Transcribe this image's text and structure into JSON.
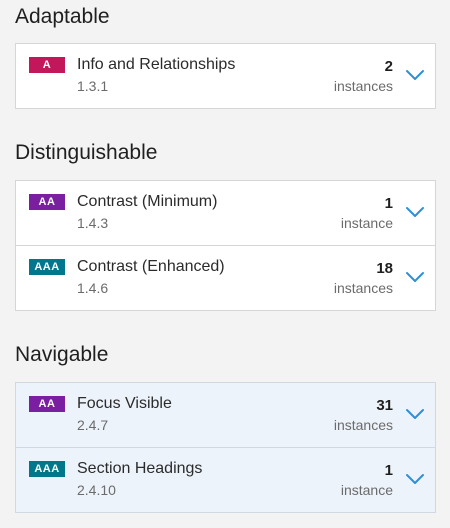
{
  "sections": [
    {
      "title": "Adaptable",
      "rows": [
        {
          "level": "A",
          "name": "Info and Relationships",
          "code": "1.3.1",
          "count": "2",
          "unit": "instances"
        }
      ]
    },
    {
      "title": "Distinguishable",
      "rows": [
        {
          "level": "AA",
          "name": "Contrast (Minimum)",
          "code": "1.4.3",
          "count": "1",
          "unit": "instance"
        },
        {
          "level": "AAA",
          "name": "Contrast (Enhanced)",
          "code": "1.4.6",
          "count": "18",
          "unit": "instances"
        }
      ]
    },
    {
      "title": "Navigable",
      "rows": [
        {
          "level": "AA",
          "name": "Focus Visible",
          "code": "2.4.7",
          "count": "31",
          "unit": "instances"
        },
        {
          "level": "AAA",
          "name": "Section Headings",
          "code": "2.4.10",
          "count": "1",
          "unit": "instance"
        }
      ]
    }
  ],
  "colors": {
    "level_A": "#c2185b",
    "level_AA": "#7b1fa2",
    "level_AAA": "#00778b",
    "chevron": "#2f8fd6"
  },
  "icons": {
    "expand": "chevron-down-icon"
  }
}
